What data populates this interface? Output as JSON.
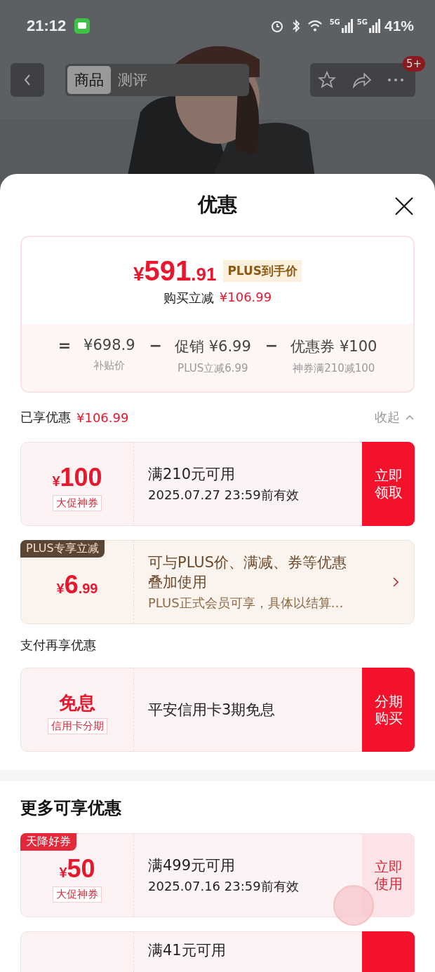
{
  "status_bar": {
    "time": "21:12",
    "network_1": "5G",
    "network_2": "5G",
    "battery": "41%"
  },
  "nav": {
    "tabs": [
      {
        "label": "商品",
        "selected": true
      },
      {
        "label": "测评",
        "selected": false
      }
    ],
    "badge": "5+"
  },
  "sheet": {
    "title": "优惠",
    "summary": {
      "currency": "¥",
      "price_int": "591",
      "price_dec": ".91",
      "price_tag": "PLUS到手价",
      "reduce_label": "购买立减",
      "reduce_value": "¥106.99",
      "breakdown": [
        {
          "sign": "=",
          "value": "¥698.9",
          "caption": "补贴价"
        },
        {
          "sign": "−",
          "value": "促销 ¥6.99",
          "caption": "PLUS立减6.99"
        },
        {
          "sign": "−",
          "value": "优惠券 ¥100",
          "caption": "神券满210减100"
        }
      ]
    },
    "enjoyed": {
      "label": "已享优惠",
      "amount": "¥106.99",
      "toggle": "收起",
      "expanded": true
    },
    "coupons": [
      {
        "kind": "coupon",
        "currency": "¥",
        "amount": "100",
        "tag": "大促神券",
        "title": "满210元可用",
        "subtitle": "2025.07.27 23:59前有效",
        "action": "立即领取",
        "filled": true
      },
      {
        "kind": "plus",
        "ribbon": "PLUS专享立减",
        "currency": "¥",
        "amount": "6",
        "decimal": ".99",
        "title": "可与PLUS价、满减、券等优惠叠加使用",
        "subtitle": "PLUS正式会员可享，具体以结算…"
      }
    ],
    "pay_heading": "支付再享优惠",
    "pay_coupons": [
      {
        "kind": "coupon",
        "amount": "免息",
        "tag": "信用卡分期",
        "title": "平安信用卡3期免息",
        "action": "分期购买",
        "filled": true
      }
    ],
    "more_heading": "更多可享优惠",
    "more_coupons": [
      {
        "kind": "coupon",
        "ribbon": "天降好券",
        "currency": "¥",
        "amount": "50",
        "tag": "大促神券",
        "title": "满499元可用",
        "subtitle": "2025.07.16 23:59前有效",
        "action": "立即使用",
        "filled": false,
        "claimed": true
      },
      {
        "kind": "coupon",
        "title": "满41元可用",
        "filled": true
      }
    ]
  }
}
